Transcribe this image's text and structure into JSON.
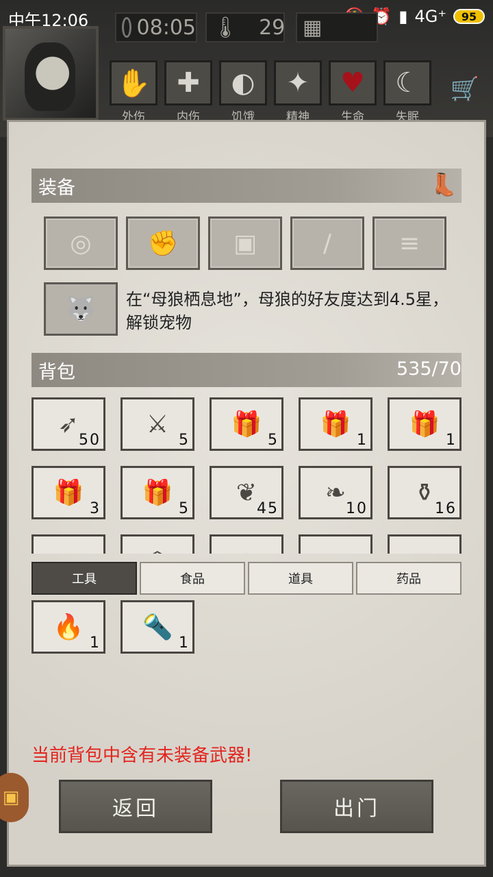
{
  "statusbar": {
    "time": "中午12:06",
    "network": "4G⁺",
    "battery": "95"
  },
  "hud": {
    "clock": "08:05",
    "temperature": "29"
  },
  "conditions": [
    {
      "label": "外伤",
      "icon": "bandaged-hand-icon",
      "glyph": "✋"
    },
    {
      "label": "内伤",
      "icon": "cross-icon",
      "glyph": "✚"
    },
    {
      "label": "饥饿",
      "icon": "stomach-icon",
      "glyph": "◐"
    },
    {
      "label": "精神",
      "icon": "head-stars-icon",
      "glyph": "✦"
    },
    {
      "label": "生命",
      "icon": "heart-icon",
      "glyph": "♥"
    },
    {
      "label": "失眠",
      "icon": "moon-icon",
      "glyph": "☾"
    }
  ],
  "equipment": {
    "title": "装备",
    "slots": [
      {
        "icon": "target-icon",
        "glyph": "◎"
      },
      {
        "icon": "fist-icon",
        "glyph": "✊"
      },
      {
        "icon": "jacket-icon",
        "glyph": "▣"
      },
      {
        "icon": "torch-icon",
        "glyph": "/"
      },
      {
        "icon": "logs-icon",
        "glyph": "≡"
      }
    ],
    "pet_hint": "在“母狼栖息地”，母狼的好友度达到4.5星，解锁宠物"
  },
  "bag": {
    "title": "背包",
    "capacity": "535/70",
    "items": [
      [
        {
          "icon": "arrows-icon",
          "glyph": "➶",
          "count": "50"
        },
        {
          "icon": "saber-icon",
          "glyph": "⚔",
          "count": "5"
        },
        {
          "icon": "food-pack-icon",
          "glyph": "🎁",
          "count": "5"
        },
        {
          "icon": "medicine-pack-icon",
          "glyph": "🎁",
          "count": "1"
        },
        {
          "icon": "weapon-pack-icon",
          "glyph": "🎁",
          "count": "1"
        }
      ],
      [
        {
          "icon": "tool-pack-icon",
          "glyph": "🎁",
          "count": "3"
        },
        {
          "icon": "wood-pack-icon",
          "glyph": "🎁",
          "count": "5"
        },
        {
          "icon": "herb-branch-icon",
          "glyph": "❦",
          "count": "45"
        },
        {
          "icon": "ginseng-icon",
          "glyph": "❧",
          "count": "10"
        },
        {
          "icon": "bottle-icon",
          "glyph": "⚱",
          "count": "16"
        }
      ],
      [
        {
          "icon": "plank-icon",
          "glyph": "▭",
          "count": ""
        },
        {
          "icon": "honeycomb-icon",
          "glyph": "⬡",
          "count": ""
        },
        {
          "icon": "meat-icon",
          "glyph": "◍",
          "count": ""
        },
        {
          "icon": "orb-icon",
          "glyph": "●",
          "count": ""
        },
        {
          "icon": "feather-icon",
          "glyph": "➹",
          "count": ""
        }
      ]
    ]
  },
  "tabs": [
    "工具",
    "食品",
    "道具",
    "药品"
  ],
  "tools": [
    {
      "icon": "torch-item-icon",
      "glyph": "🔥",
      "count": "1"
    },
    {
      "icon": "flashlight-icon",
      "glyph": "🔦",
      "count": "1"
    }
  ],
  "warning": "当前背包中含有未装备武器!",
  "buttons": {
    "back": "返回",
    "exit": "出门"
  },
  "colors": {
    "warning": "#e3241f",
    "heart": "#a5121a"
  }
}
